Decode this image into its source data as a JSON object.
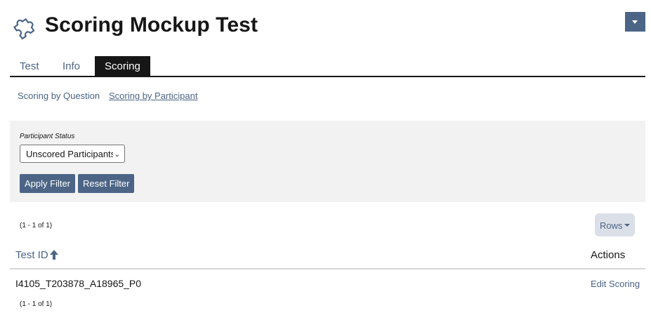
{
  "header": {
    "title": "Scoring Mockup Test",
    "icon": "puzzle-piece-icon",
    "menu_icon": "caret-down-icon"
  },
  "tabs": [
    {
      "label": "Test",
      "active": false
    },
    {
      "label": "Info",
      "active": false
    },
    {
      "label": "Scoring",
      "active": true
    }
  ],
  "subtabs": [
    {
      "label": "Scoring by Question",
      "active": false
    },
    {
      "label": "Scoring by Participant",
      "active": true
    }
  ],
  "filter": {
    "label": "Participant Status",
    "selected": "Unscored Participants",
    "apply_label": "Apply Filter",
    "reset_label": "Reset Filter"
  },
  "table": {
    "count_top": "(1 - 1 of 1)",
    "count_bottom": "(1 - 1 of 1)",
    "rows_label": "Rows",
    "columns": [
      "Test ID",
      "Actions"
    ],
    "sort_icon": "arrow-up-icon",
    "rows": [
      {
        "test_id": "I4105_T203878_A18965_P0",
        "action": "Edit Scoring"
      }
    ]
  },
  "colors": {
    "accent": "#4c6586",
    "tab_active_bg": "#161616",
    "filter_bg": "#f2f2f2"
  }
}
